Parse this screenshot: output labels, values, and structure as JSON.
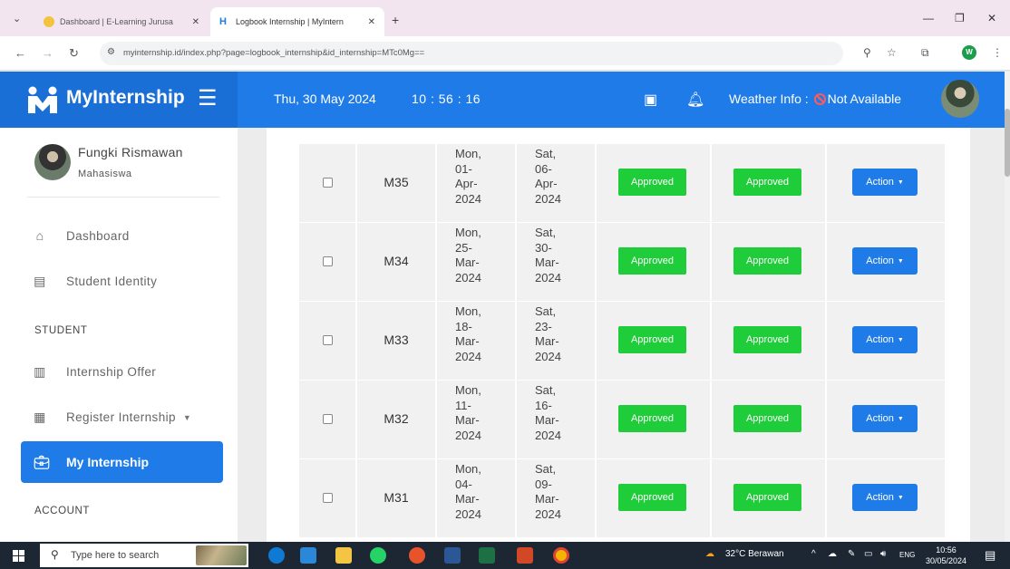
{
  "browser": {
    "tabs": [
      {
        "title": "Dashboard | E-Learning Jurusa",
        "active": false
      },
      {
        "title": "Logbook Internship | MyIntern",
        "active": true
      }
    ],
    "url": "myinternship.id/index.php?page=logbook_internship&id_internship=MTc0Mg=="
  },
  "header": {
    "brand": "MyInternship",
    "date": "Thu, 30 May 2024",
    "time": "10 : 56 : 16",
    "weather_label": "Weather Info :",
    "weather_value": "Not Available"
  },
  "sidebar": {
    "user_name": "Fungki Rismawan",
    "user_role": "Mahasiswa",
    "items": [
      {
        "label": "Dashboard",
        "icon": "home-icon"
      },
      {
        "label": "Student Identity",
        "icon": "id-card-icon"
      }
    ],
    "section_student": "STUDENT",
    "student_items": [
      {
        "label": "Internship Offer",
        "icon": "clipboard-icon"
      },
      {
        "label": "Register Internship",
        "icon": "form-icon"
      },
      {
        "label": "My Internship",
        "icon": "briefcase-icon"
      }
    ],
    "section_account": "ACCOUNT"
  },
  "table": {
    "rows": [
      {
        "code": "M35",
        "start": "Mon,\n01-\nApr-\n2024",
        "end": "Sat,\n06-\nApr-\n2024",
        "status1": "Approved",
        "status2": "Approved",
        "action": "Action"
      },
      {
        "code": "M34",
        "start": "Mon,\n25-\nMar-\n2024",
        "end": "Sat,\n30-\nMar-\n2024",
        "status1": "Approved",
        "status2": "Approved",
        "action": "Action"
      },
      {
        "code": "M33",
        "start": "Mon,\n18-\nMar-\n2024",
        "end": "Sat,\n23-\nMar-\n2024",
        "status1": "Approved",
        "status2": "Approved",
        "action": "Action"
      },
      {
        "code": "M32",
        "start": "Mon,\n11-\nMar-\n2024",
        "end": "Sat,\n16-\nMar-\n2024",
        "status1": "Approved",
        "status2": "Approved",
        "action": "Action"
      },
      {
        "code": "M31",
        "start": "Mon,\n04-\nMar-\n2024",
        "end": "Sat,\n09-\nMar-\n2024",
        "status1": "Approved",
        "status2": "Approved",
        "action": "Action"
      }
    ]
  },
  "taskbar": {
    "search_placeholder": "Type here to search",
    "weather": "32°C  Berawan",
    "lang": "ENG",
    "time": "10:56",
    "date": "30/05/2024"
  },
  "colors": {
    "primary": "#1e7be8",
    "approved": "#1fcc3a"
  }
}
